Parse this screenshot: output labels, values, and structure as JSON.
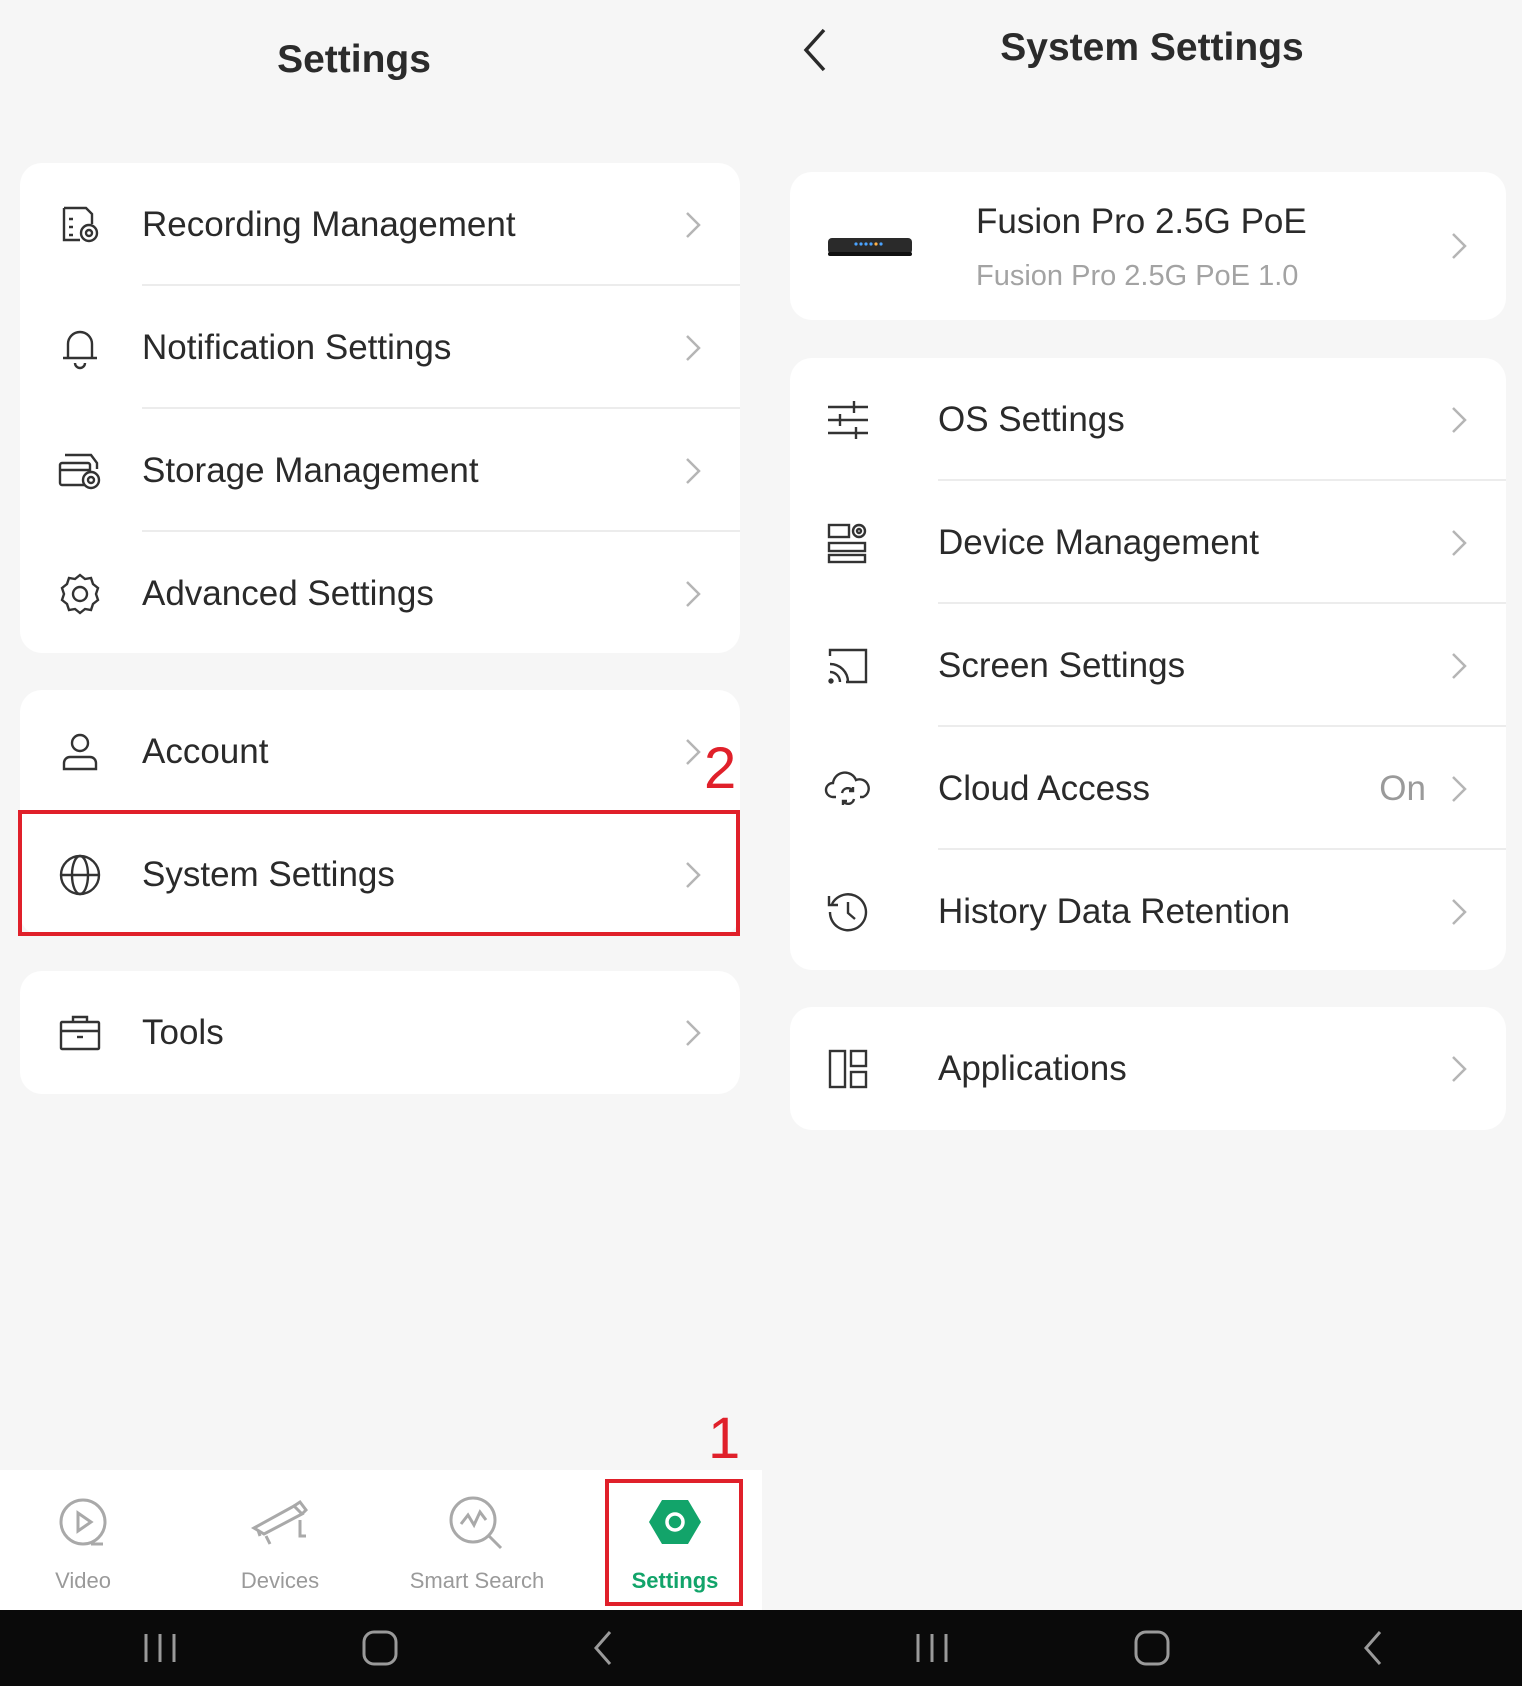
{
  "left_screen": {
    "title": "Settings",
    "group1": [
      {
        "label": "Recording Management",
        "icon": "recording-management-icon"
      },
      {
        "label": "Notification Settings",
        "icon": "bell-icon"
      },
      {
        "label": "Storage Management",
        "icon": "storage-icon"
      },
      {
        "label": "Advanced Settings",
        "icon": "gear-icon"
      }
    ],
    "group2": [
      {
        "label": "Account",
        "icon": "person-icon"
      },
      {
        "label": "System Settings",
        "icon": "globe-icon"
      }
    ],
    "group3": [
      {
        "label": "Tools",
        "icon": "toolbox-icon"
      }
    ],
    "tabs": [
      {
        "label": "Video",
        "icon": "play-circle-icon"
      },
      {
        "label": "Devices",
        "icon": "camera-icon"
      },
      {
        "label": "Smart Search",
        "icon": "smart-search-icon"
      },
      {
        "label": "Settings",
        "icon": "hexagon-settings-icon"
      }
    ],
    "active_tab": "Settings"
  },
  "right_screen": {
    "title": "System Settings",
    "device": {
      "name": "Fusion Pro 2.5G PoE",
      "model": "Fusion Pro 2.5G PoE 1.0"
    },
    "group1": [
      {
        "label": "OS Settings",
        "icon": "sliders-icon"
      },
      {
        "label": "Device Management",
        "icon": "device-management-icon"
      },
      {
        "label": "Screen Settings",
        "icon": "cast-icon"
      },
      {
        "label": "Cloud Access",
        "icon": "cloud-sync-icon",
        "value": "On"
      },
      {
        "label": "History Data Retention",
        "icon": "history-icon"
      }
    ],
    "group2": [
      {
        "label": "Applications",
        "icon": "apps-icon"
      }
    ]
  },
  "annotations": {
    "step1": "1",
    "step2": "2"
  },
  "colors": {
    "accent": "#12a46a",
    "highlight": "#e0202a",
    "background": "#f6f6f6"
  }
}
